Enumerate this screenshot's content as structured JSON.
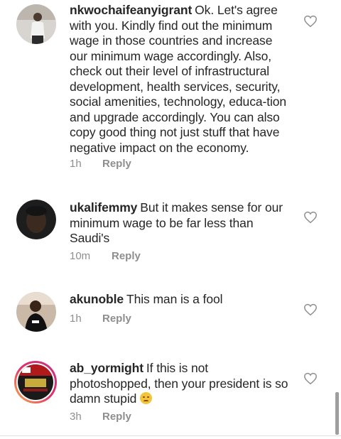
{
  "comments": [
    {
      "username": "nkwochaifeanyigrant",
      "text": "Ok. Let's agree with you. Kindly find out the minimum wage in those countries and increase our minimum wage accordingly. Also, check out their level of infrastructural development, health services, security, social amenities, technology, educa-tion and upgrade accordingly. You can also copy good thing not just stuff that have negative impact on the economy.",
      "time": "1h",
      "reply_label": "Reply"
    },
    {
      "username": "ukalifemmy",
      "text": "But it makes sense for our minimum wage to be far less than Saudi's",
      "time": "10m",
      "reply_label": "Reply"
    },
    {
      "username": "akunoble",
      "text": "This man is a fool",
      "time": "1h",
      "reply_label": "Reply"
    },
    {
      "username": "ab_yormight",
      "text": "If this is not photoshopped, then your president is so damn stupid",
      "time": "3h",
      "reply_label": "Reply",
      "emoji": "angry-face-emoji"
    }
  ],
  "colors": {
    "text": "#262626",
    "muted": "#8e8e8e",
    "story_ring": "#e1306c"
  }
}
